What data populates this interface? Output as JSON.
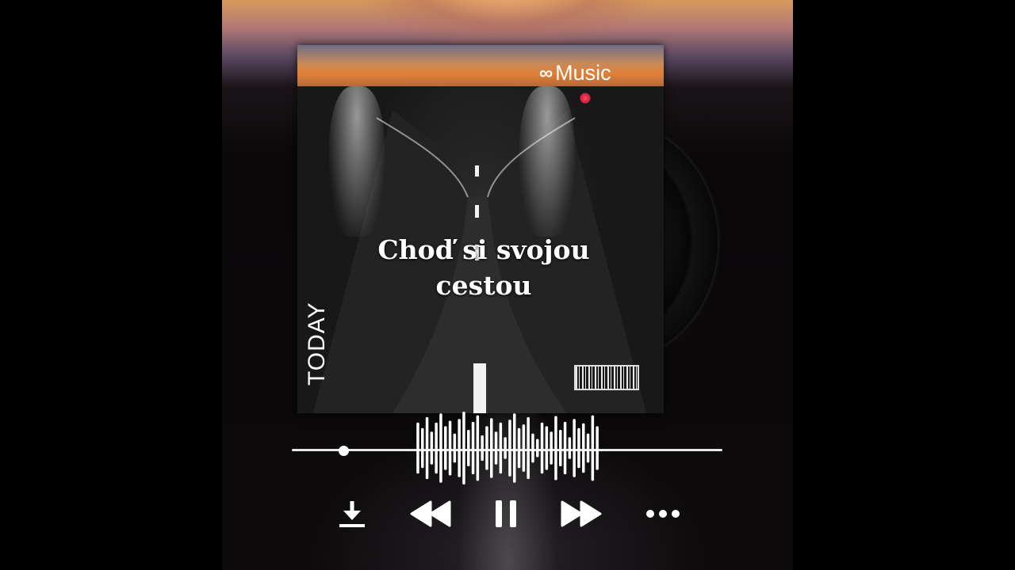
{
  "cover": {
    "brand_mark": "∞",
    "brand_label": "Music",
    "title": "Choď si svojou cestou",
    "side_label": "TODAY"
  },
  "player": {
    "progress": 0.12,
    "state": "playing",
    "waveform": [
      0.7,
      0.55,
      0.85,
      0.45,
      0.7,
      0.95,
      0.6,
      0.75,
      0.4,
      0.8,
      1.0,
      0.5,
      0.72,
      0.9,
      0.35,
      0.6,
      0.82,
      0.45,
      0.7,
      0.3,
      0.78,
      0.95,
      0.55,
      0.65,
      0.85,
      0.4,
      0.25,
      0.7,
      0.6,
      0.45,
      0.88,
      0.5,
      0.72,
      0.3,
      0.8,
      0.55,
      0.68,
      0.4,
      0.9,
      0.6
    ],
    "controls": [
      "download-icon",
      "rewind-icon",
      "pause-icon",
      "fast-forward-icon",
      "more-icon"
    ]
  },
  "colors": {
    "accent": "#ffffff",
    "sky": "#e07f35",
    "background": "#0a0809"
  }
}
